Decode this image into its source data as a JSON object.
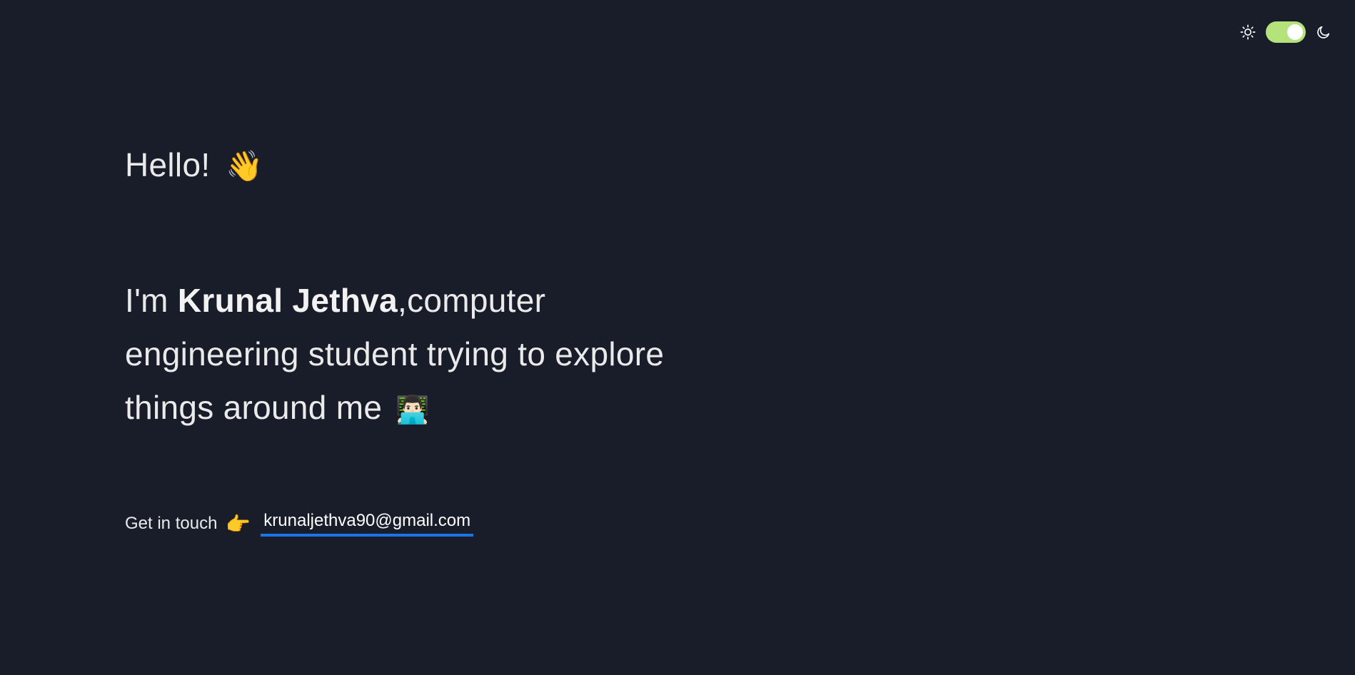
{
  "theme_toggle": {
    "light_icon": "sun-icon",
    "dark_icon": "moon-icon",
    "state": "dark",
    "track_color": "#b3e37a"
  },
  "hero": {
    "greeting": "Hello!",
    "greeting_emoji": "👋",
    "intro_prefix": "I'm ",
    "name": "Krunal Jethva",
    "intro_suffix": ",computer engineering student trying to explore things around me",
    "intro_emoji": "👨🏻‍💻"
  },
  "contact": {
    "label": "Get in touch",
    "pointer_emoji": "👉",
    "email": "krunaljethva90@gmail.com",
    "link_underline_color": "#1a73e8"
  },
  "colors": {
    "background": "#191d2a",
    "text": "#eaeaea"
  }
}
